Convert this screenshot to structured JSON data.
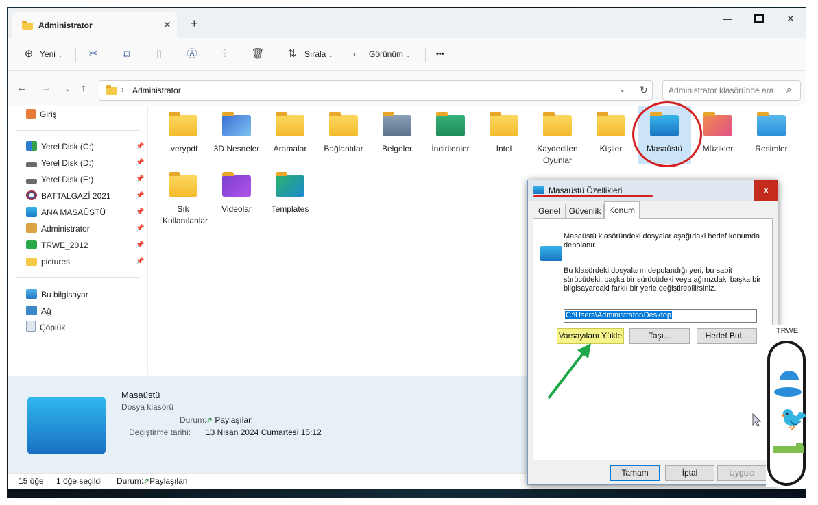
{
  "colors": {
    "accent": "#0067c0",
    "highlight": "#f4f48a",
    "annotation_red": "#d42020",
    "annotation_green": "#1fa84a",
    "close_red": "#c42b1c"
  },
  "window": {
    "tab_title": "Administrator",
    "new_tab": "+",
    "controls": {
      "minimize": "—",
      "maximize": "☐",
      "close": "✕"
    }
  },
  "toolbar": {
    "new_label": "Yeni",
    "icons": [
      "cut-icon",
      "copy-icon",
      "paste-icon",
      "rename-icon",
      "share-icon",
      "delete-icon"
    ],
    "sort_label": "Sırala",
    "view_label": "Görünüm",
    "more": "•••"
  },
  "address": {
    "path": "Administrator",
    "separator": "›",
    "search_placeholder": "Administrator klasöründe ara"
  },
  "sidebar": {
    "home": "Giriş",
    "items": [
      {
        "label": "Yerel Disk (C:)",
        "icon": "windows-drive-icon"
      },
      {
        "label": "Yerel Disk (D:)",
        "icon": "drive-icon"
      },
      {
        "label": "Yerel Disk (E:)",
        "icon": "drive-icon"
      },
      {
        "label": "BATTALGAZİ 2021",
        "icon": "app-icon"
      },
      {
        "label": "ANA MASAÜSTÜ",
        "icon": "desktop-icon"
      },
      {
        "label": "Administrator",
        "icon": "user-icon"
      },
      {
        "label": "TRWE_2012",
        "icon": "app-icon"
      },
      {
        "label": "pictures",
        "icon": "folder-icon"
      }
    ],
    "system": [
      {
        "label": "Bu bilgisayar",
        "icon": "computer-icon"
      },
      {
        "label": "Ağ",
        "icon": "network-icon"
      },
      {
        "label": "Çöplük",
        "icon": "recycle-bin-icon"
      }
    ]
  },
  "folders": [
    {
      "label": ".verypdf",
      "icon": "folder-icon"
    },
    {
      "label": "3D Nesneler",
      "icon": "3d-objects-icon"
    },
    {
      "label": "Aramalar",
      "icon": "folder-icon"
    },
    {
      "label": "Bağlantılar",
      "icon": "folder-icon"
    },
    {
      "label": "Belgeler",
      "icon": "documents-icon"
    },
    {
      "label": "İndirilenler",
      "icon": "downloads-icon"
    },
    {
      "label": "Intel",
      "icon": "folder-icon"
    },
    {
      "label": "Kaydedilen Oyunlar",
      "icon": "folder-icon"
    },
    {
      "label": "Kişiler",
      "icon": "folder-icon"
    },
    {
      "label": "Masaüstü",
      "icon": "desktop-folder-icon"
    },
    {
      "label": "Müzikler",
      "icon": "music-icon"
    },
    {
      "label": "Resimler",
      "icon": "pictures-icon"
    },
    {
      "label": "Sık Kullanılanlar",
      "icon": "folder-icon"
    },
    {
      "label": "Videolar",
      "icon": "videos-icon"
    },
    {
      "label": "Templates",
      "icon": "shortcut-folder-icon"
    }
  ],
  "details": {
    "name": "Masaüstü",
    "type": "Dosya klasörü",
    "status_label": "Durum:",
    "status_value": "Paylaşılan",
    "modified_label": "Değiştirme tarihi:",
    "modified_value": "13 Nisan 2024 Cumartesi 15:12"
  },
  "status_bar": {
    "count": "15 öğe",
    "selected": "1 öğe seçildi",
    "status_label": "Durum:",
    "status_value": "Paylaşılan"
  },
  "dialog": {
    "title": "Masaüstü Özellikleri",
    "close": "x",
    "tabs": [
      "Genel",
      "Güvenlik",
      "Konum"
    ],
    "active_tab": "Konum",
    "desc1": "Masaüstü klasöründeki dosyalar aşağıdaki hedef konumda depolanır.",
    "desc2": "Bu klasördeki dosyaların depolandığı yeri, bu sabit sürücüdeki, başka bir sürücüdeki veya ağınızdaki başka bir bilgisayardaki farklı bir yerle değiştirebilirsiniz.",
    "path": "C:\\Users\\Administrator\\Desktop",
    "btn_restore": "Varsayılanı Yükle",
    "btn_move": "Taşı...",
    "btn_find": "Hedef Bul...",
    "btn_ok": "Tamam",
    "btn_cancel": "İptal",
    "btn_apply": "Uygula"
  },
  "widget": {
    "title": "TRWE"
  }
}
